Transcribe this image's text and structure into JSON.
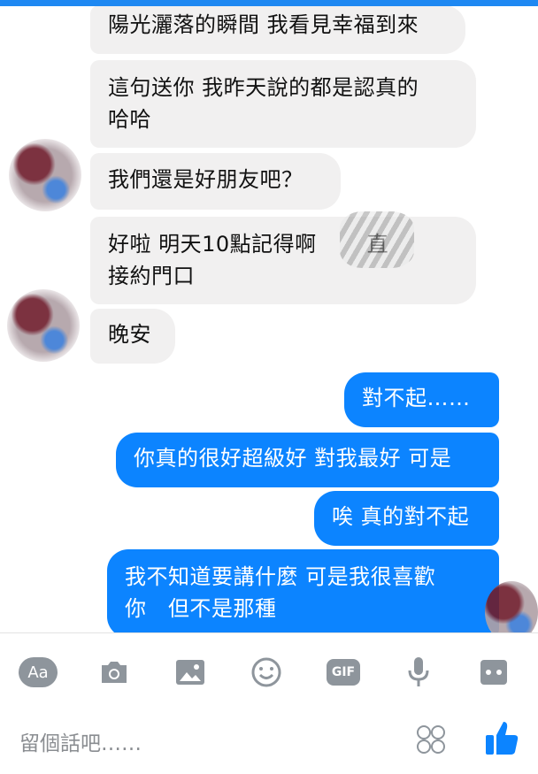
{
  "messages": [
    {
      "side": "in",
      "text": "陽光灑落的瞬間 我看見幸福到來"
    },
    {
      "side": "in",
      "text": "這句送你 我昨天說的都是認真的\n哈哈"
    },
    {
      "side": "in",
      "text": "我們還是好朋友吧？"
    },
    {
      "side": "in",
      "text": "好啦 明天10點記得啊       直\n接約門口"
    },
    {
      "side": "in",
      "text": "晚安"
    },
    {
      "side": "out",
      "text": "對不起……"
    },
    {
      "side": "out",
      "text": "你真的很好超級好 對我最好 可是"
    },
    {
      "side": "out",
      "text": "唉 真的對不起"
    },
    {
      "side": "out",
      "text": "我不知道要講什麼 可是我很喜歡\n你   但不是那種"
    }
  ],
  "toolbar": {
    "aa_label": "Aa",
    "gif_label": "GIF",
    "icons": [
      "text-format-icon",
      "camera-icon",
      "image-icon",
      "emoji-icon",
      "gif-icon",
      "microphone-icon",
      "more-icon"
    ]
  },
  "composer": {
    "placeholder": "留個話吧……"
  },
  "colors": {
    "accent": "#0c84ff",
    "incoming_bubble": "#f1f0f0",
    "icon_gray": "#8e959c"
  }
}
